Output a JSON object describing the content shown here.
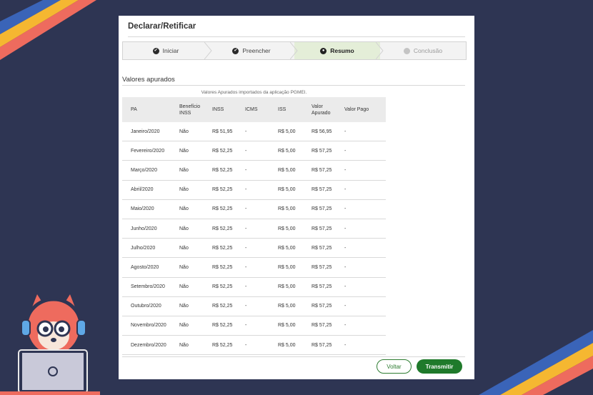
{
  "page_title": "Declarar/Retificar",
  "steps": [
    {
      "label": "Iniciar",
      "icon": "check-circle-icon",
      "state": "done"
    },
    {
      "label": "Preencher",
      "icon": "check-circle-icon",
      "state": "done"
    },
    {
      "label": "Resumo",
      "icon": "dot-circle-icon",
      "state": "active"
    },
    {
      "label": "Conclusão",
      "icon": "circle-icon",
      "state": "disabled"
    }
  ],
  "section_title": "Valores apurados",
  "table_caption": "Valores Apurados importados da aplicação PGMEI.",
  "table": {
    "headers": [
      "PA",
      "Benefício INSS",
      "INSS",
      "ICMS",
      "ISS",
      "Valor Apurado",
      "Valor Pago"
    ],
    "rows": [
      [
        "Janeiro/2020",
        "Não",
        "R$ 51,95",
        "-",
        "R$ 5,00",
        "R$ 56,95",
        "-"
      ],
      [
        "Fevereiro/2020",
        "Não",
        "R$ 52,25",
        "-",
        "R$ 5,00",
        "R$ 57,25",
        "-"
      ],
      [
        "Março/2020",
        "Não",
        "R$ 52,25",
        "-",
        "R$ 5,00",
        "R$ 57,25",
        "-"
      ],
      [
        "Abril/2020",
        "Não",
        "R$ 52,25",
        "-",
        "R$ 5,00",
        "R$ 57,25",
        "-"
      ],
      [
        "Maio/2020",
        "Não",
        "R$ 52,25",
        "-",
        "R$ 5,00",
        "R$ 57,25",
        "-"
      ],
      [
        "Junho/2020",
        "Não",
        "R$ 52,25",
        "-",
        "R$ 5,00",
        "R$ 57,25",
        "-"
      ],
      [
        "Julho/2020",
        "Não",
        "R$ 52,25",
        "-",
        "R$ 5,00",
        "R$ 57,25",
        "-"
      ],
      [
        "Agosto/2020",
        "Não",
        "R$ 52,25",
        "-",
        "R$ 5,00",
        "R$ 57,25",
        "-"
      ],
      [
        "Setembro/2020",
        "Não",
        "R$ 52,25",
        "-",
        "R$ 5,00",
        "R$ 57,25",
        "-"
      ],
      [
        "Outubro/2020",
        "Não",
        "R$ 52,25",
        "-",
        "R$ 5,00",
        "R$ 57,25",
        "-"
      ],
      [
        "Novembro/2020",
        "Não",
        "R$ 52,25",
        "-",
        "R$ 5,00",
        "R$ 57,25",
        "-"
      ],
      [
        "Dezembro/2020",
        "Não",
        "R$ 52,25",
        "-",
        "R$ 5,00",
        "R$ 57,25",
        "-"
      ]
    ]
  },
  "buttons": {
    "back": "Voltar",
    "submit": "Transmitir"
  },
  "colors": {
    "background": "#2e3553",
    "accent_green": "#1f7a2b",
    "active_step": "#e4eed8",
    "stripe_blue": "#3a64b8",
    "stripe_yellow": "#f5b731",
    "stripe_coral": "#ee6b5e"
  }
}
